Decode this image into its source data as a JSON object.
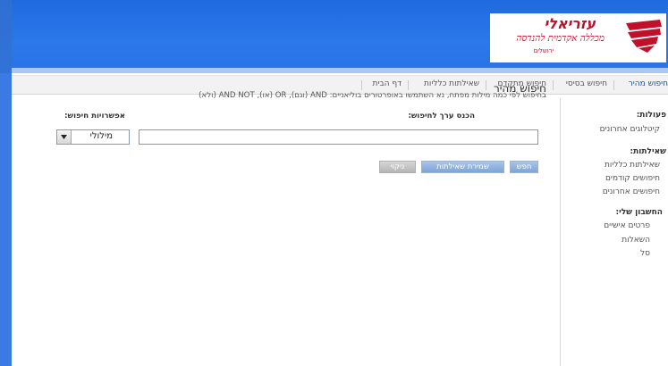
{
  "header": {
    "logo": {
      "title": "עזריאלי",
      "subtitle": "מכללה אקדמית להנדסה",
      "city": "ירושלים"
    }
  },
  "nav": {
    "items": [
      {
        "label": "חיפוש מהיר",
        "active": true
      },
      {
        "label": "חיפוש בסיסי",
        "active": false
      },
      {
        "label": "חיפוש מתקדם",
        "active": false
      },
      {
        "label": "שאילתות כלליות",
        "active": false
      },
      {
        "label": "דף הבית",
        "active": false
      }
    ]
  },
  "sidebar": {
    "actions_heading": "פעולות:",
    "actions": [
      "קיטלוגים אחרונים"
    ],
    "queries_heading": "שאילתות:",
    "queries": [
      "שאילתות כלליות",
      "חיפושים קודמים",
      "חיפושים אחרונים"
    ],
    "account_heading": "החשבון שלי:",
    "account": [
      "פרטים אישיים",
      "השאלות",
      "סל"
    ]
  },
  "main": {
    "title": "חיפוש מהיר",
    "description": "בחיפוש לפי כמה מילות מפתח, נא השתמשו באופרטורים בוליאניים: AND (וגם), OR (או), AND NOT (ולא)",
    "enter_label": "הכנס ערך לחיפוש:",
    "options_label": "אפשרויות חיפוש:",
    "search_value": "",
    "select_value": "מילולי",
    "buttons": {
      "search": "חפש",
      "save_query": "שמירת שאילתות",
      "clear": "ניקוי"
    }
  },
  "colors": {
    "header_blue": "#2b78ea",
    "brand_red": "#c0102a",
    "nav_active": "#1f4fa8"
  }
}
